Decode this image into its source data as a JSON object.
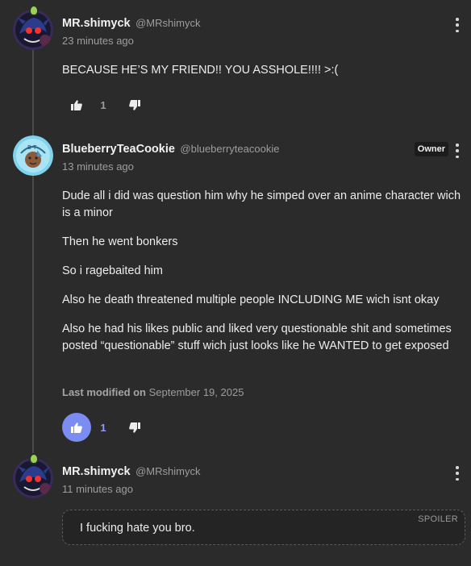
{
  "comments": [
    {
      "author": "MR.shimyck",
      "handle": "@MRshimyck",
      "time": "23 minutes ago",
      "text": "BECAUSE HE’S MY FRIEND!! YOU ASSHOLE!!!! >:(",
      "likes": "1",
      "liked": false
    },
    {
      "author": "BlueberryTeaCookie",
      "handle": "@blueberryteacookie",
      "time": "13 minutes ago",
      "badge": "Owner",
      "paragraphs": [
        "Dude all i did was question him why he simped over an anime character wich is a minor",
        "Then he went bonkers",
        "So i ragebaited him",
        "Also he death threatened multiple people INCLUDING ME wich isnt okay",
        "Also he had his likes public and liked very questionable shit and sometimes posted “questionable” stuff wich just looks like he WANTED to get exposed"
      ],
      "modified_label": "Last modified on",
      "modified_date": "September 19, 2025",
      "likes": "1",
      "liked": true
    },
    {
      "author": "MR.shimyck",
      "handle": "@MRshimyck",
      "time": "11 minutes ago",
      "spoiler_label": "SPOILER",
      "spoiler_text": "I fucking hate you bro."
    }
  ],
  "icons": {
    "like": "thumbs-up-icon",
    "dislike": "thumbs-down-icon",
    "menu": "more-vertical-icon"
  },
  "colors": {
    "background": "#2b2b2b",
    "accent": "#7b8cf2",
    "text": "#ececec",
    "muted": "#9d9d9d"
  }
}
